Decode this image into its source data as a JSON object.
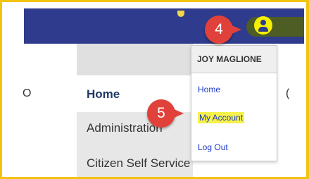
{
  "header": {
    "user_icon": "user-circle-icon",
    "colors": {
      "bar": "#2f3b8c",
      "user_icon": "#f5ef00",
      "callout": "#e0413a",
      "highlight": "#f6f14a"
    }
  },
  "callouts": [
    {
      "number": "4"
    },
    {
      "number": "5"
    }
  ],
  "nav": {
    "items": [
      {
        "label": "Home"
      },
      {
        "label": "Administration"
      },
      {
        "label": "Citizen Self Service"
      }
    ],
    "left_edge_char": "O",
    "right_edge_char": "("
  },
  "user_menu": {
    "name": "JOY MAGLIONE",
    "items": [
      {
        "label": "Home"
      },
      {
        "label": "My Account",
        "highlighted": true
      },
      {
        "label": "Log Out"
      }
    ]
  }
}
